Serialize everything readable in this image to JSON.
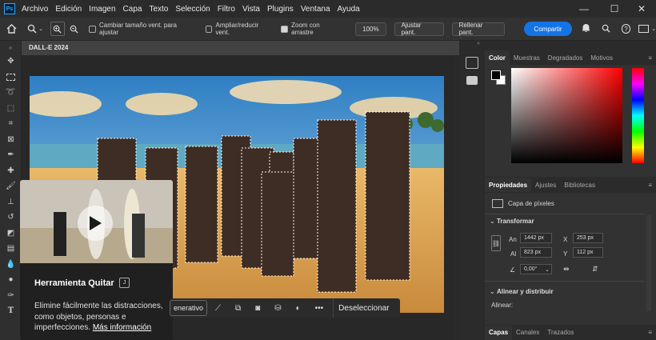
{
  "app_badge": "Ps",
  "menu": [
    "Archivo",
    "Edición",
    "Imagen",
    "Capa",
    "Texto",
    "Selección",
    "Filtro",
    "Vista",
    "Plugins",
    "Ventana",
    "Ayuda"
  ],
  "window_buttons": [
    "—",
    "☐",
    "✕"
  ],
  "options": {
    "cb1": "Cambiar tamaño vent. para ajustar",
    "cb2": "Ampliar/reducir vent.",
    "cb3": "Zoom con arrastre",
    "zoom": "100%",
    "fit": "Ajustar pant.",
    "fill": "Rellenar pant.",
    "share": "Compartir"
  },
  "document_tab": "DALL-E 2024",
  "color_panel": {
    "tabs": [
      "Color",
      "Muestras",
      "Degradados",
      "Motivos"
    ],
    "hue_color": "#ff0000"
  },
  "properties": {
    "tabs": [
      "Propiedades",
      "Ajustes",
      "Bibliotecas"
    ],
    "layer_type": "Capa de píxeles",
    "transform_label": "Transformar",
    "an_label": "An",
    "an": "1442 px",
    "al_label": "Al",
    "al": "823 px",
    "x_label": "X",
    "x": "253 px",
    "y_label": "Y",
    "y": "112 px",
    "angle": "0,00°",
    "align_label": "Alinear y distribuir",
    "align_sub": "Alinear:"
  },
  "layers_tabs": [
    "Capas",
    "Canales",
    "Trazados"
  ],
  "popup": {
    "title": "Herramienta Quitar",
    "desc": "Elimine fácilmente las distracciones, como objetos, personas e imperfecciones.",
    "link": "Más información"
  },
  "contextbar": {
    "generative": "enerativo",
    "deselect": "Deseleccionar"
  }
}
